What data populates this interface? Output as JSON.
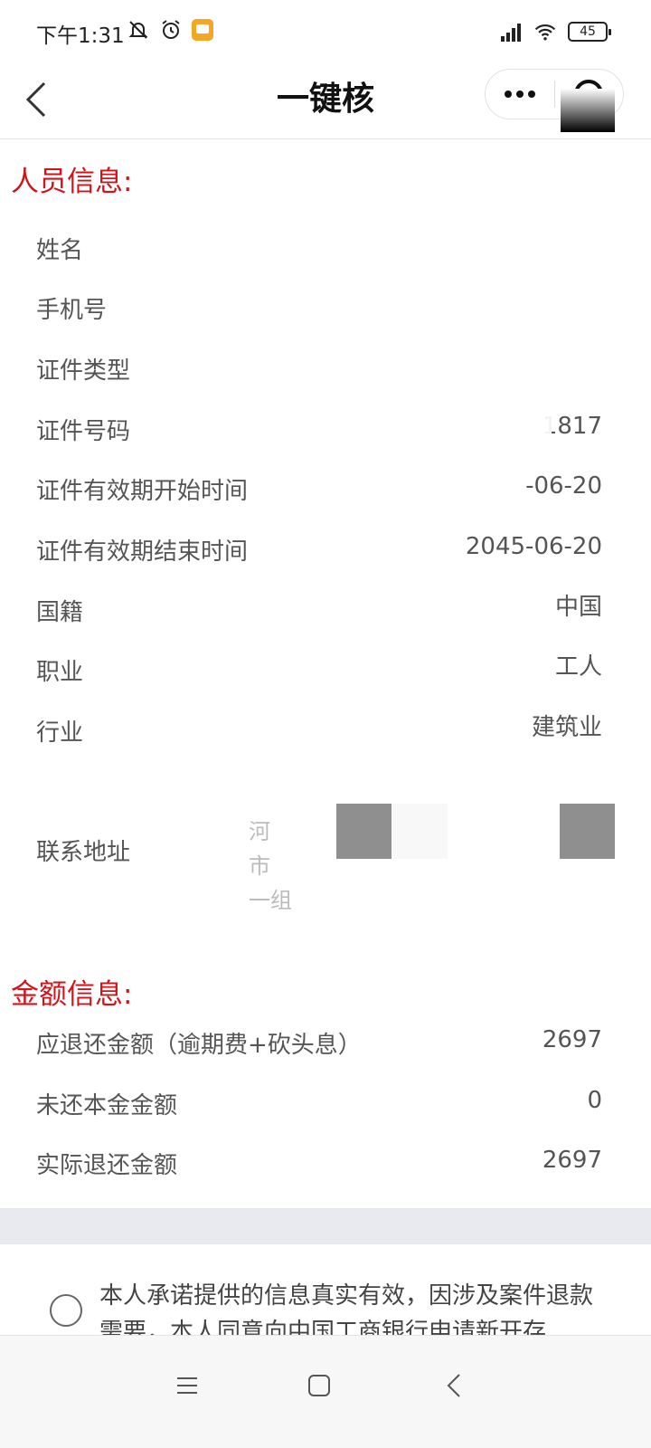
{
  "status_bar": {
    "time": "下午1:31",
    "battery": "45",
    "icons": [
      "bell-off-icon",
      "alarm-icon",
      "notification-icon",
      "signal-icon",
      "wifi-icon",
      "battery-icon"
    ]
  },
  "nav": {
    "title": "一键核",
    "icons": [
      "back-icon",
      "more-icon",
      "target-icon"
    ]
  },
  "person_section": {
    "title": "人员信息:",
    "rows": [
      {
        "label": "姓名",
        "value": ""
      },
      {
        "label": "手机号",
        "value": ""
      },
      {
        "label": "证件类型",
        "value": ""
      },
      {
        "label": "证件号码",
        "value": "1817"
      },
      {
        "label": "证件有效期开始时间",
        "value": "-06-20"
      },
      {
        "label": "证件有效期结束时间",
        "value": "2045-06-20"
      },
      {
        "label": "国籍",
        "value": "中国"
      },
      {
        "label": "职业",
        "value": "工人"
      },
      {
        "label": "行业",
        "value": "建筑业"
      }
    ],
    "address": {
      "label": "联系地址",
      "lines": [
        "河",
        "市",
        "一组"
      ]
    }
  },
  "amount_section": {
    "title": "金额信息:",
    "rows": [
      {
        "label": "应退还金额（逾期费+砍头息）",
        "value": "2697"
      },
      {
        "label": "未还本金金额",
        "value": "0"
      },
      {
        "label": "实际退还金额",
        "value": "2697"
      }
    ]
  },
  "consent": {
    "text": "本人承诺提供的信息真实有效，因涉及案件退款需要，本人同意向中国工商银行申请新开存"
  },
  "system_nav": {
    "icons": [
      "menu-icon",
      "home-icon",
      "back-nav-icon"
    ]
  },
  "colors": {
    "accent_red": "#d0141a",
    "band": "#e9eaef"
  }
}
